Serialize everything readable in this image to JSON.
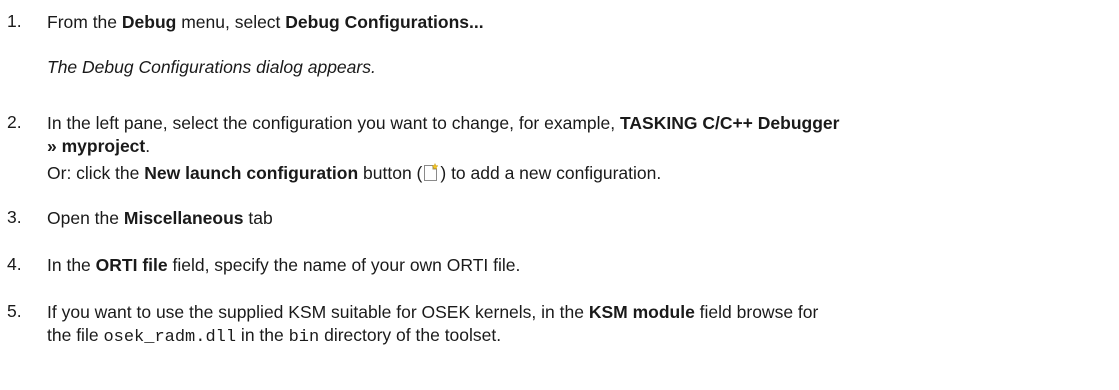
{
  "steps": [
    {
      "number": "1.",
      "text_1": "From the ",
      "bold_1": "Debug",
      "text_2": " menu, select ",
      "bold_2": "Debug Configurations...",
      "result": "The Debug Configurations dialog appears."
    },
    {
      "number": "2.",
      "text_1": "In the left pane, select the configuration you want to change, for example, ",
      "bold_1": "TASKING C/C++ Debugger",
      "bold_2": "» myproject",
      "text_2": ".",
      "or_text_1": "Or: click the ",
      "or_bold": "New launch configuration",
      "or_text_2": " button (",
      "or_icon": "new-launch-configuration-icon",
      "or_text_3": ") to add a new configuration."
    },
    {
      "number": "3.",
      "text_1": "Open the ",
      "bold_1": "Miscellaneous",
      "text_2": " tab"
    },
    {
      "number": "4.",
      "text_1": "In the ",
      "bold_1": "ORTI file",
      "text_2": " field, specify the name of your own ORTI file."
    },
    {
      "number": "5.",
      "text_1": "If you want to use the supplied KSM suitable for OSEK kernels, in the ",
      "bold_1": "KSM module",
      "text_2": " field browse for",
      "text_3": "the file ",
      "code_1": "osek_radm.dll",
      "text_4": " in the ",
      "code_2": "bin",
      "text_5": " directory of the toolset."
    }
  ]
}
